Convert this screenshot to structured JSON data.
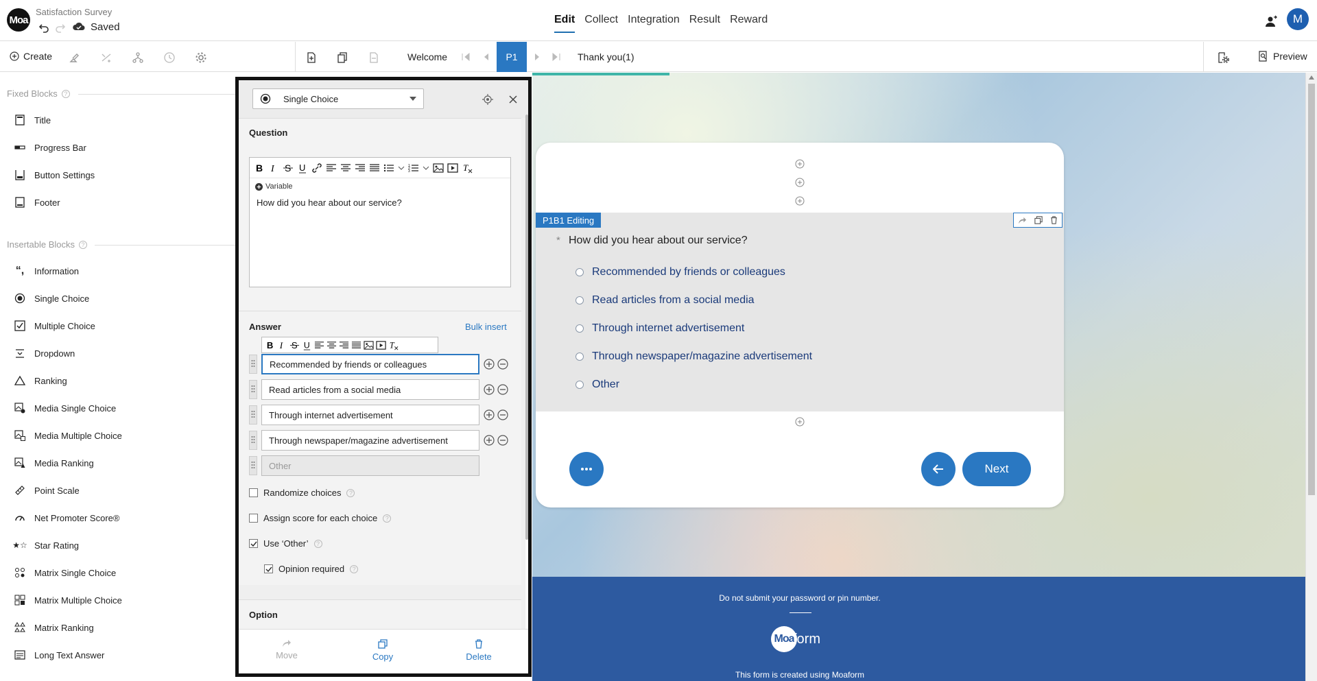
{
  "header": {
    "logo_text": "Moa",
    "survey_title": "Satisfaction Survey",
    "save_status": "Saved",
    "nav": [
      "Edit",
      "Collect",
      "Integration",
      "Result",
      "Reward"
    ],
    "active_nav": "Edit",
    "avatar_letter": "M"
  },
  "toolbar": {
    "create_label": "Create",
    "pages": {
      "welcome": "Welcome",
      "current": "P1",
      "thanks": "Thank you(1)"
    },
    "preview_label": "Preview"
  },
  "sidebar": {
    "fixed_heading": "Fixed Blocks",
    "fixed": [
      "Title",
      "Progress Bar",
      "Button Settings",
      "Footer"
    ],
    "insertable_heading": "Insertable Blocks",
    "insertable": [
      "Information",
      "Single Choice",
      "Multiple Choice",
      "Dropdown",
      "Ranking",
      "Media Single Choice",
      "Media Multiple Choice",
      "Media Ranking",
      "Point Scale",
      "Net Promoter Score®",
      "Star Rating",
      "Matrix Single Choice",
      "Matrix Multiple Choice",
      "Matrix Ranking",
      "Long Text Answer"
    ]
  },
  "editor": {
    "type_label": "Single Choice",
    "question_heading": "Question",
    "variable_label": "Variable",
    "question_text": "How did you hear about our service?",
    "answer_heading": "Answer",
    "bulk_insert": "Bulk insert",
    "answers": [
      "Recommended by friends or colleagues",
      "Read articles from a social media",
      "Through internet advertisement",
      "Through newspaper/magazine advertisement"
    ],
    "other_placeholder": "Other",
    "options": [
      {
        "label": "Randomize choices",
        "checked": false
      },
      {
        "label": "Assign score for each choice",
        "checked": false
      },
      {
        "label": "Use ‘Other’",
        "checked": true
      },
      {
        "label": "Opinion required",
        "checked": true
      }
    ],
    "option_heading": "Option",
    "footer": {
      "move": "Move",
      "copy": "Copy",
      "delete": "Delete"
    }
  },
  "preview": {
    "edit_tag": "P1B1 Editing",
    "question": "How did you hear about our service?",
    "choices": [
      "Recommended by friends or colleagues",
      "Read articles from a social media",
      "Through internet advertisement",
      "Through newspaper/magazine advertisement",
      "Other"
    ],
    "next_label": "Next",
    "footer_note": "Do not submit your password or pin number.",
    "footer_logo_a": "Moa",
    "footer_logo_b": "form",
    "footer_created": "This form is created using Moaform"
  },
  "colors": {
    "accent": "#2a78c2",
    "footer": "#2d5aa0"
  }
}
